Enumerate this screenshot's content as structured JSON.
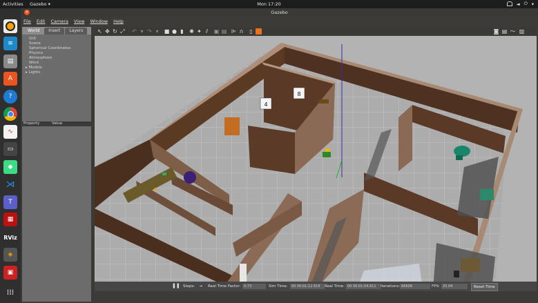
{
  "topbar": {
    "activities": "Activities",
    "app_name": "Gazebo ▾",
    "clock": "Mon 17:20",
    "tray": [
      "▾",
      "⋮",
      "⏻"
    ]
  },
  "dock": {
    "items": [
      "gazebo",
      "text-editor",
      "files",
      "software",
      "help",
      "chrome",
      "recorder",
      "terminal",
      "android-studio",
      "vscode",
      "teams",
      "system-monitor",
      "rviz",
      "layers",
      "screenshot",
      "apps"
    ]
  },
  "window": {
    "title": "Gazebo",
    "menu": [
      "File",
      "Edit",
      "Camera",
      "View",
      "Window",
      "Help"
    ]
  },
  "left_panel": {
    "tabs": [
      "World",
      "Insert",
      "Layers"
    ],
    "tree": [
      "GUI",
      "Scene",
      "Spherical Coordinates",
      "Physics",
      "Atmosphere",
      "Wind",
      "Models",
      "Lights"
    ],
    "tree_expandable": [
      "Models",
      "Lights"
    ],
    "prop_headers": [
      "Property",
      "Value"
    ]
  },
  "toolbar": {
    "icons": [
      "select-icon",
      "translate-icon",
      "rotate-icon",
      "scale-icon",
      "undo-icon",
      "redo-icon",
      "box-icon",
      "sphere-icon",
      "cylinder-icon",
      "pointlight-icon",
      "spotlight-icon",
      "dirlight-icon",
      "copy-icon",
      "paste-icon",
      "align-icon",
      "snap-icon",
      "orange-icon"
    ],
    "right_icons": [
      "camera-icon",
      "record-icon",
      "plot-icon",
      "view-icon"
    ]
  },
  "status": {
    "pause": "❚❚",
    "steps": "Steps:",
    "rtf_label": "Real Time Factor:",
    "rtf": "0.73",
    "sim_label": "Sim Time:",
    "sim": "00 00:01:12.616",
    "real_label": "Real Time:",
    "real": "00 00:01:04.611",
    "iter_label": "Iterations:",
    "iter": "66608",
    "fps_label": "FPS:",
    "fps": "20.04",
    "reset": "Reset Time"
  }
}
